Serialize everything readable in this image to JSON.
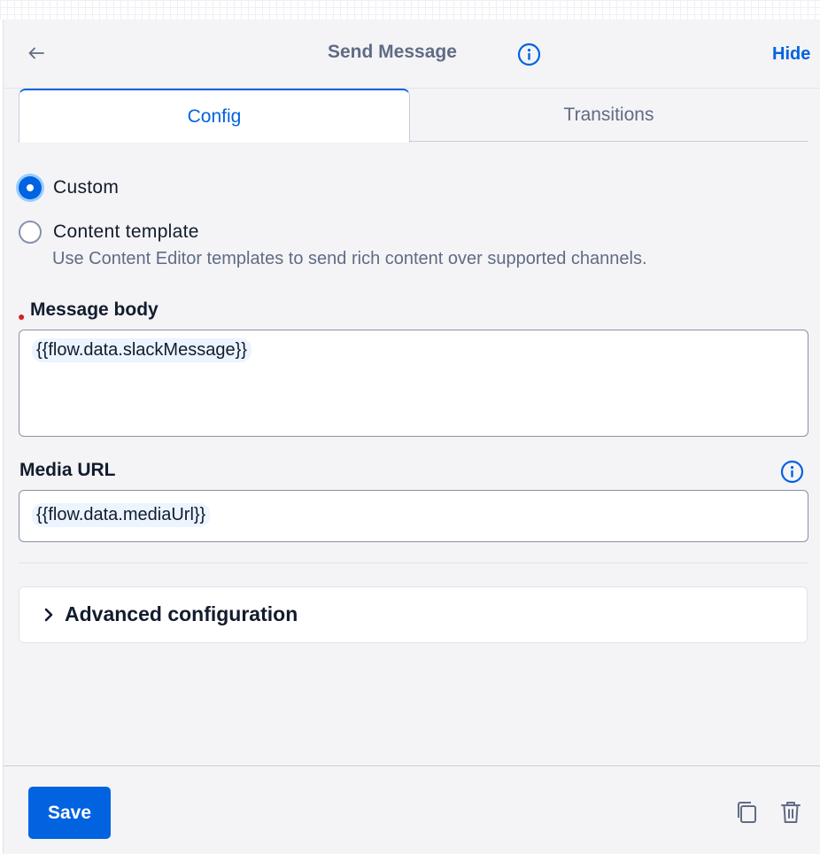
{
  "header": {
    "title": "Send Message",
    "hide_label": "Hide",
    "back_icon": "arrow-left-icon",
    "info_icon": "info-icon"
  },
  "tabs": [
    {
      "label": "Config",
      "active": true
    },
    {
      "label": "Transitions",
      "active": false
    }
  ],
  "source_options": {
    "custom": {
      "label": "Custom",
      "checked": true
    },
    "content_template": {
      "label": "Content template",
      "checked": false,
      "help": "Use Content Editor templates to send rich content over supported channels."
    }
  },
  "message_body": {
    "label": "Message body",
    "required": true,
    "value": "{{flow.data.slackMessage}}"
  },
  "media_url": {
    "label": "Media URL",
    "value": "{{flow.data.mediaUrl}}"
  },
  "advanced": {
    "label": "Advanced configuration",
    "expanded": false
  },
  "footer": {
    "save_label": "Save",
    "duplicate_icon": "copy-icon",
    "delete_icon": "trash-icon"
  },
  "colors": {
    "accent": "#0263e0",
    "panel_bg": "#f4f4f6",
    "required": "#d61f1f",
    "muted_text": "#606b85"
  }
}
